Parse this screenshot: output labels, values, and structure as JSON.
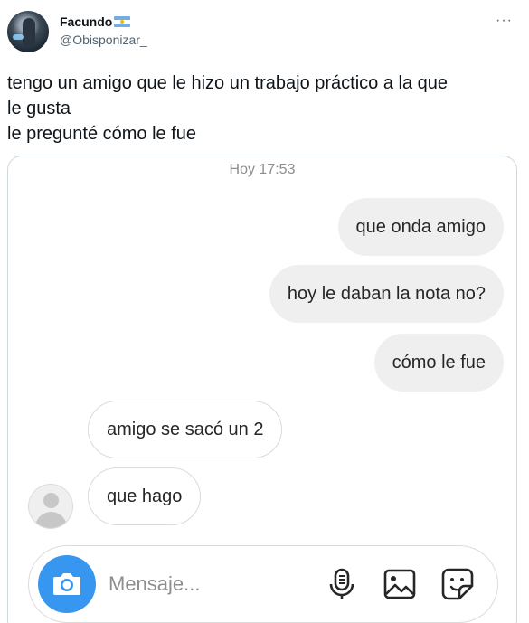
{
  "tweet": {
    "display_name": "Facundo",
    "handle": "@Obisponizar_",
    "more_label": "···",
    "text": "tengo un amigo que le hizo un trabajo práctico a la que\nle gusta\nle pregunté cómo le fue"
  },
  "chat": {
    "timestamp": "Hoy 17:53",
    "messages": [
      {
        "from": "me",
        "text": "que onda amigo"
      },
      {
        "from": "me",
        "text": "hoy le daban la nota no?"
      },
      {
        "from": "me",
        "text": "cómo le fue"
      },
      {
        "from": "friend",
        "text": "amigo se sacó un 2"
      },
      {
        "from": "friend",
        "text": "que hago"
      }
    ],
    "composer": {
      "placeholder": "Mensaje..."
    }
  },
  "colors": {
    "accent": "#3797f0",
    "outgoing_bubble": "#efefef",
    "incoming_border": "#dbdbdb"
  },
  "icons": [
    "flag-argentina-icon",
    "more-icon",
    "camera-icon",
    "microphone-icon",
    "gallery-icon",
    "sticker-icon",
    "contact-avatar-icon"
  ]
}
